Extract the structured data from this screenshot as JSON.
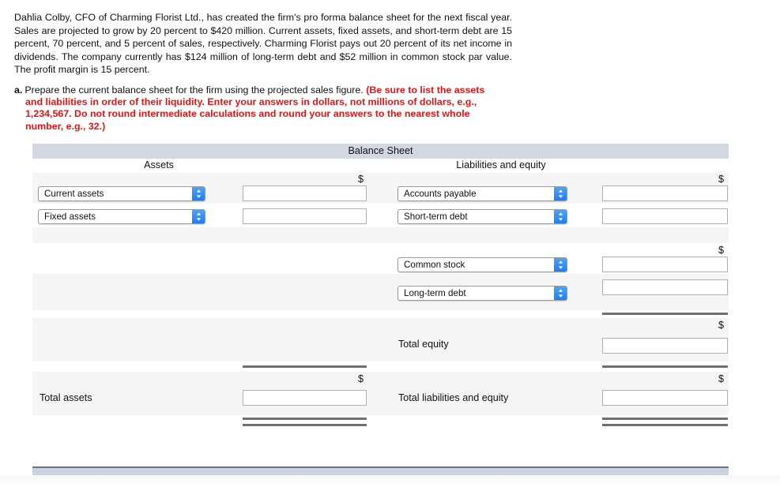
{
  "problem": {
    "statement": "Dahlia Colby, CFO of Charming Florist Ltd., has created the firm's pro forma balance sheet for the next fiscal year. Sales are projected to grow by 20 percent to $420 million. Current assets, fixed assets, and short-term debt are 15 percent, 70 percent, and 5 percent of sales, respectively. Charming Florist pays out 20 percent of its net income in dividends. The company currently has $124 million of long-term debt and $52 million in common stock par value. The profit margin is 15 percent."
  },
  "question": {
    "letter": "a.",
    "prompt": "Prepare the current balance sheet for the firm using the projected sales figure.",
    "red_note": "(Be sure to list the assets and liabilities in order of their liquidity. Enter your answers in dollars, not millions of dollars, e.g., 1,234,567. Do not round intermediate calculations and round your answers to the nearest whole number, e.g., 32.)"
  },
  "balance_sheet": {
    "title": "Balance Sheet",
    "assets_header": "Assets",
    "liabilities_header": "Liabilities and equity",
    "dollar_sign": "$",
    "assets": {
      "row1_select": "Current assets",
      "row1_value": "",
      "row2_select": "Fixed assets",
      "row2_value": "",
      "total_label": "Total assets",
      "total_value": ""
    },
    "liabilities": {
      "row1_select": "Accounts payable",
      "row1_value": "",
      "row2_select": "Short-term debt",
      "row2_value": "",
      "row3_select": "Common stock",
      "row3_value": "",
      "row4_select": "Long-term debt",
      "row4_value": "",
      "total_equity_label": "Total equity",
      "total_equity_value": "",
      "total_label": "Total liabilities and equity",
      "total_value": ""
    }
  },
  "colors": {
    "title_bar": "#d2d7e2",
    "band_row": "#f5f5f5",
    "red_text": "#ee1111",
    "select_arrow": "#1f7def",
    "rule": "#6f6f6f",
    "bottom_strip": "#ccd3e0"
  }
}
